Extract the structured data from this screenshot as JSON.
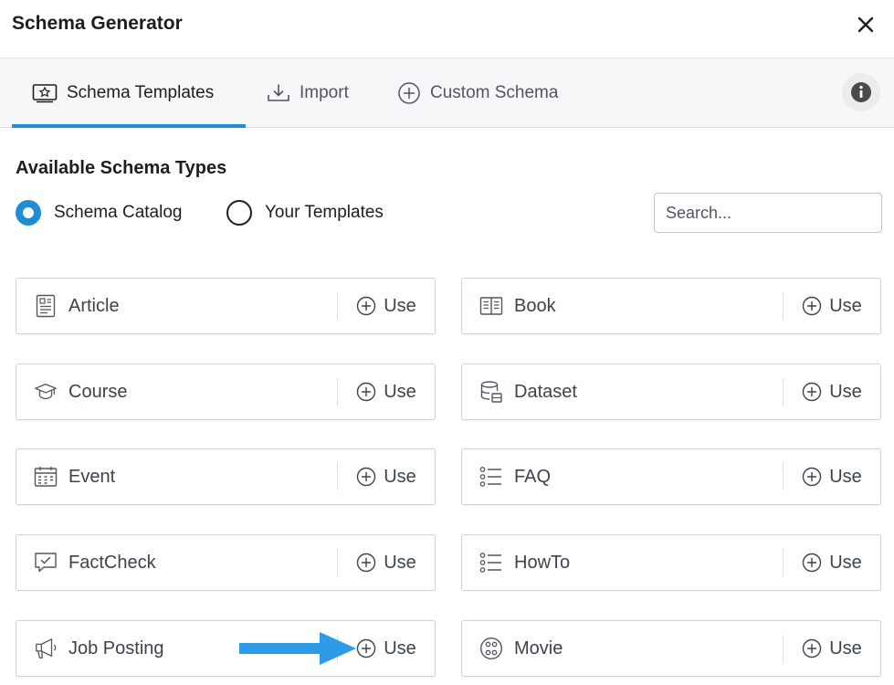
{
  "header": {
    "title": "Schema Generator"
  },
  "tabs": [
    {
      "label": "Schema Templates",
      "icon": "templates-icon",
      "active": true
    },
    {
      "label": "Import",
      "icon": "import-icon",
      "active": false
    },
    {
      "label": "Custom Schema",
      "icon": "plus-circle-icon",
      "active": false
    }
  ],
  "section": {
    "title": "Available Schema Types",
    "radios": [
      {
        "label": "Schema Catalog",
        "checked": true
      },
      {
        "label": "Your Templates",
        "checked": false
      }
    ],
    "search_placeholder": "Search..."
  },
  "cards": [
    {
      "name": "Article",
      "icon": "article-icon",
      "use_label": "Use"
    },
    {
      "name": "Book",
      "icon": "book-icon",
      "use_label": "Use"
    },
    {
      "name": "Course",
      "icon": "course-icon",
      "use_label": "Use"
    },
    {
      "name": "Dataset",
      "icon": "dataset-icon",
      "use_label": "Use"
    },
    {
      "name": "Event",
      "icon": "calendar-icon",
      "use_label": "Use"
    },
    {
      "name": "FAQ",
      "icon": "list-icon",
      "use_label": "Use"
    },
    {
      "name": "FactCheck",
      "icon": "factcheck-icon",
      "use_label": "Use"
    },
    {
      "name": "HowTo",
      "icon": "list-icon",
      "use_label": "Use"
    },
    {
      "name": "Job Posting",
      "icon": "megaphone-icon",
      "use_label": "Use"
    },
    {
      "name": "Movie",
      "icon": "film-reel-icon",
      "use_label": "Use"
    }
  ],
  "colors": {
    "accent": "#1f8dd6",
    "arrow": "#2d9be8"
  }
}
